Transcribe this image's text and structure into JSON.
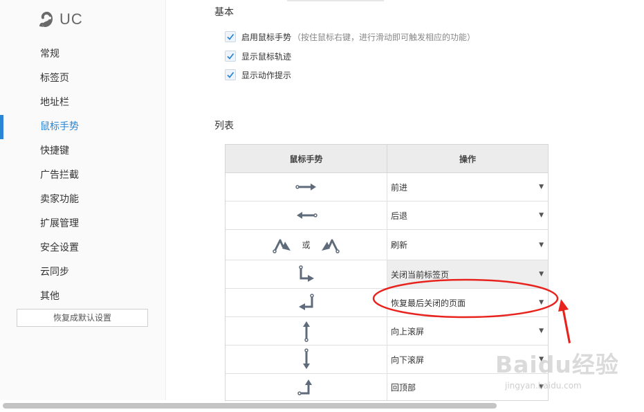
{
  "logo": {
    "text": "UC"
  },
  "sidebar": {
    "items": [
      {
        "label": "常规"
      },
      {
        "label": "标签页"
      },
      {
        "label": "地址栏"
      },
      {
        "label": "鼠标手势"
      },
      {
        "label": "快捷键"
      },
      {
        "label": "广告拦截"
      },
      {
        "label": "卖家功能"
      },
      {
        "label": "扩展管理"
      },
      {
        "label": "安全设置"
      },
      {
        "label": "云同步"
      },
      {
        "label": "其他"
      }
    ],
    "active_item": "鼠标手势",
    "restore_label": "恢复成默认设置"
  },
  "basic": {
    "title": "基本",
    "options": [
      {
        "label": "启用鼠标手势",
        "hint": "（按住鼠标右键，进行滑动即可触发相应的功能）",
        "checked": true
      },
      {
        "label": "显示鼠标轨迹",
        "hint": "",
        "checked": true
      },
      {
        "label": "显示动作提示",
        "hint": "",
        "checked": true
      }
    ]
  },
  "list": {
    "title": "列表",
    "headers": {
      "gesture": "鼠标手势",
      "action": "操作"
    },
    "or_text": "或",
    "rows": [
      {
        "gesture_icon": "arrow-right-icon",
        "action": "前进"
      },
      {
        "gesture_icon": "arrow-left-icon",
        "action": "后退"
      },
      {
        "gesture_icon": "up-down-zigzag-icon",
        "action": "刷新"
      },
      {
        "gesture_icon": "down-right-icon",
        "action": "关闭当前标签页"
      },
      {
        "gesture_icon": "up-left-icon",
        "action": "恢复最后关闭的页面"
      },
      {
        "gesture_icon": "arrow-up-icon",
        "action": "向上滚屏"
      },
      {
        "gesture_icon": "arrow-down-icon",
        "action": "向下滚屏"
      },
      {
        "gesture_icon": "left-up-icon",
        "action": "回顶部"
      }
    ],
    "highlighted_action": "关闭当前标签页"
  },
  "watermark": {
    "main": "Baidu经验",
    "sub": "jingyan.baidu.com"
  },
  "colors": {
    "accent": "#2a86d4",
    "icon": "#5f6b7a",
    "annotation": "#e8231e"
  }
}
